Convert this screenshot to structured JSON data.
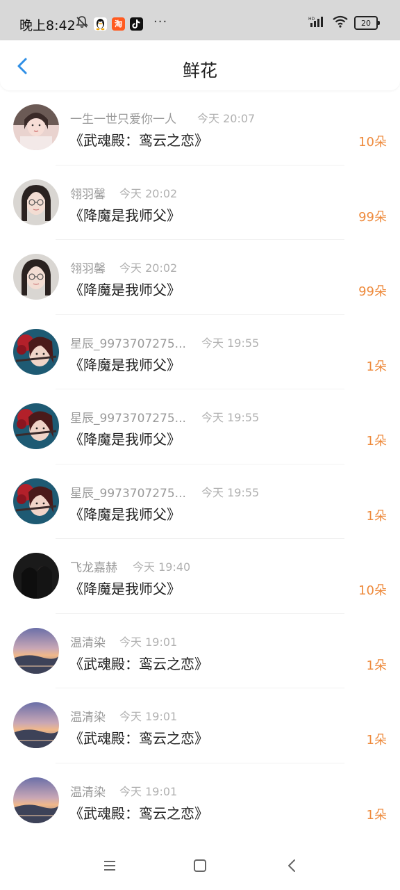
{
  "status_bar": {
    "time": "晚上8:42",
    "apps": [
      "qq-app",
      "taobao-app",
      "tiktok-app"
    ],
    "battery": "20",
    "overflow": "···"
  },
  "header": {
    "title": "鲜花",
    "accent_color": "#2f8fe6"
  },
  "colors": {
    "amount": "#ee8a3c",
    "sender": "#9a9a9a",
    "time": "#b0b0b0"
  },
  "gifts": [
    {
      "sender": "一生一世只爱你一人",
      "time": "今天 20:07",
      "book": "《武魂殿：鸾云之恋》",
      "amount": "10朵",
      "avatar": "avatar-girl-1"
    },
    {
      "sender": "翎羽馨",
      "time": "今天 20:02",
      "book": "《降魔是我师父》",
      "amount": "99朵",
      "avatar": "avatar-girl-glasses"
    },
    {
      "sender": "翎羽馨",
      "time": "今天 20:02",
      "book": "《降魔是我师父》",
      "amount": "99朵",
      "avatar": "avatar-girl-glasses"
    },
    {
      "sender": "星辰_9973707275...",
      "time": "今天 19:55",
      "book": "《降魔是我师父》",
      "amount": "1朵",
      "avatar": "avatar-anime-girl"
    },
    {
      "sender": "星辰_9973707275...",
      "time": "今天 19:55",
      "book": "《降魔是我师父》",
      "amount": "1朵",
      "avatar": "avatar-anime-girl"
    },
    {
      "sender": "星辰_9973707275...",
      "time": "今天 19:55",
      "book": "《降魔是我师父》",
      "amount": "1朵",
      "avatar": "avatar-anime-girl"
    },
    {
      "sender": "飞龙嘉赫",
      "time": "今天 19:40",
      "book": "《降魔是我师父》",
      "amount": "10朵",
      "avatar": "avatar-dark-photo"
    },
    {
      "sender": "温清染",
      "time": "今天 19:01",
      "book": "《武魂殿：鸾云之恋》",
      "amount": "1朵",
      "avatar": "avatar-sunset"
    },
    {
      "sender": "温清染",
      "time": "今天 19:01",
      "book": "《武魂殿：鸾云之恋》",
      "amount": "1朵",
      "avatar": "avatar-sunset"
    },
    {
      "sender": "温清染",
      "time": "今天 19:01",
      "book": "《武魂殿：鸾云之恋》",
      "amount": "1朵",
      "avatar": "avatar-sunset"
    }
  ],
  "nav": {
    "buttons": [
      "menu-icon",
      "home-icon",
      "back-icon"
    ]
  }
}
